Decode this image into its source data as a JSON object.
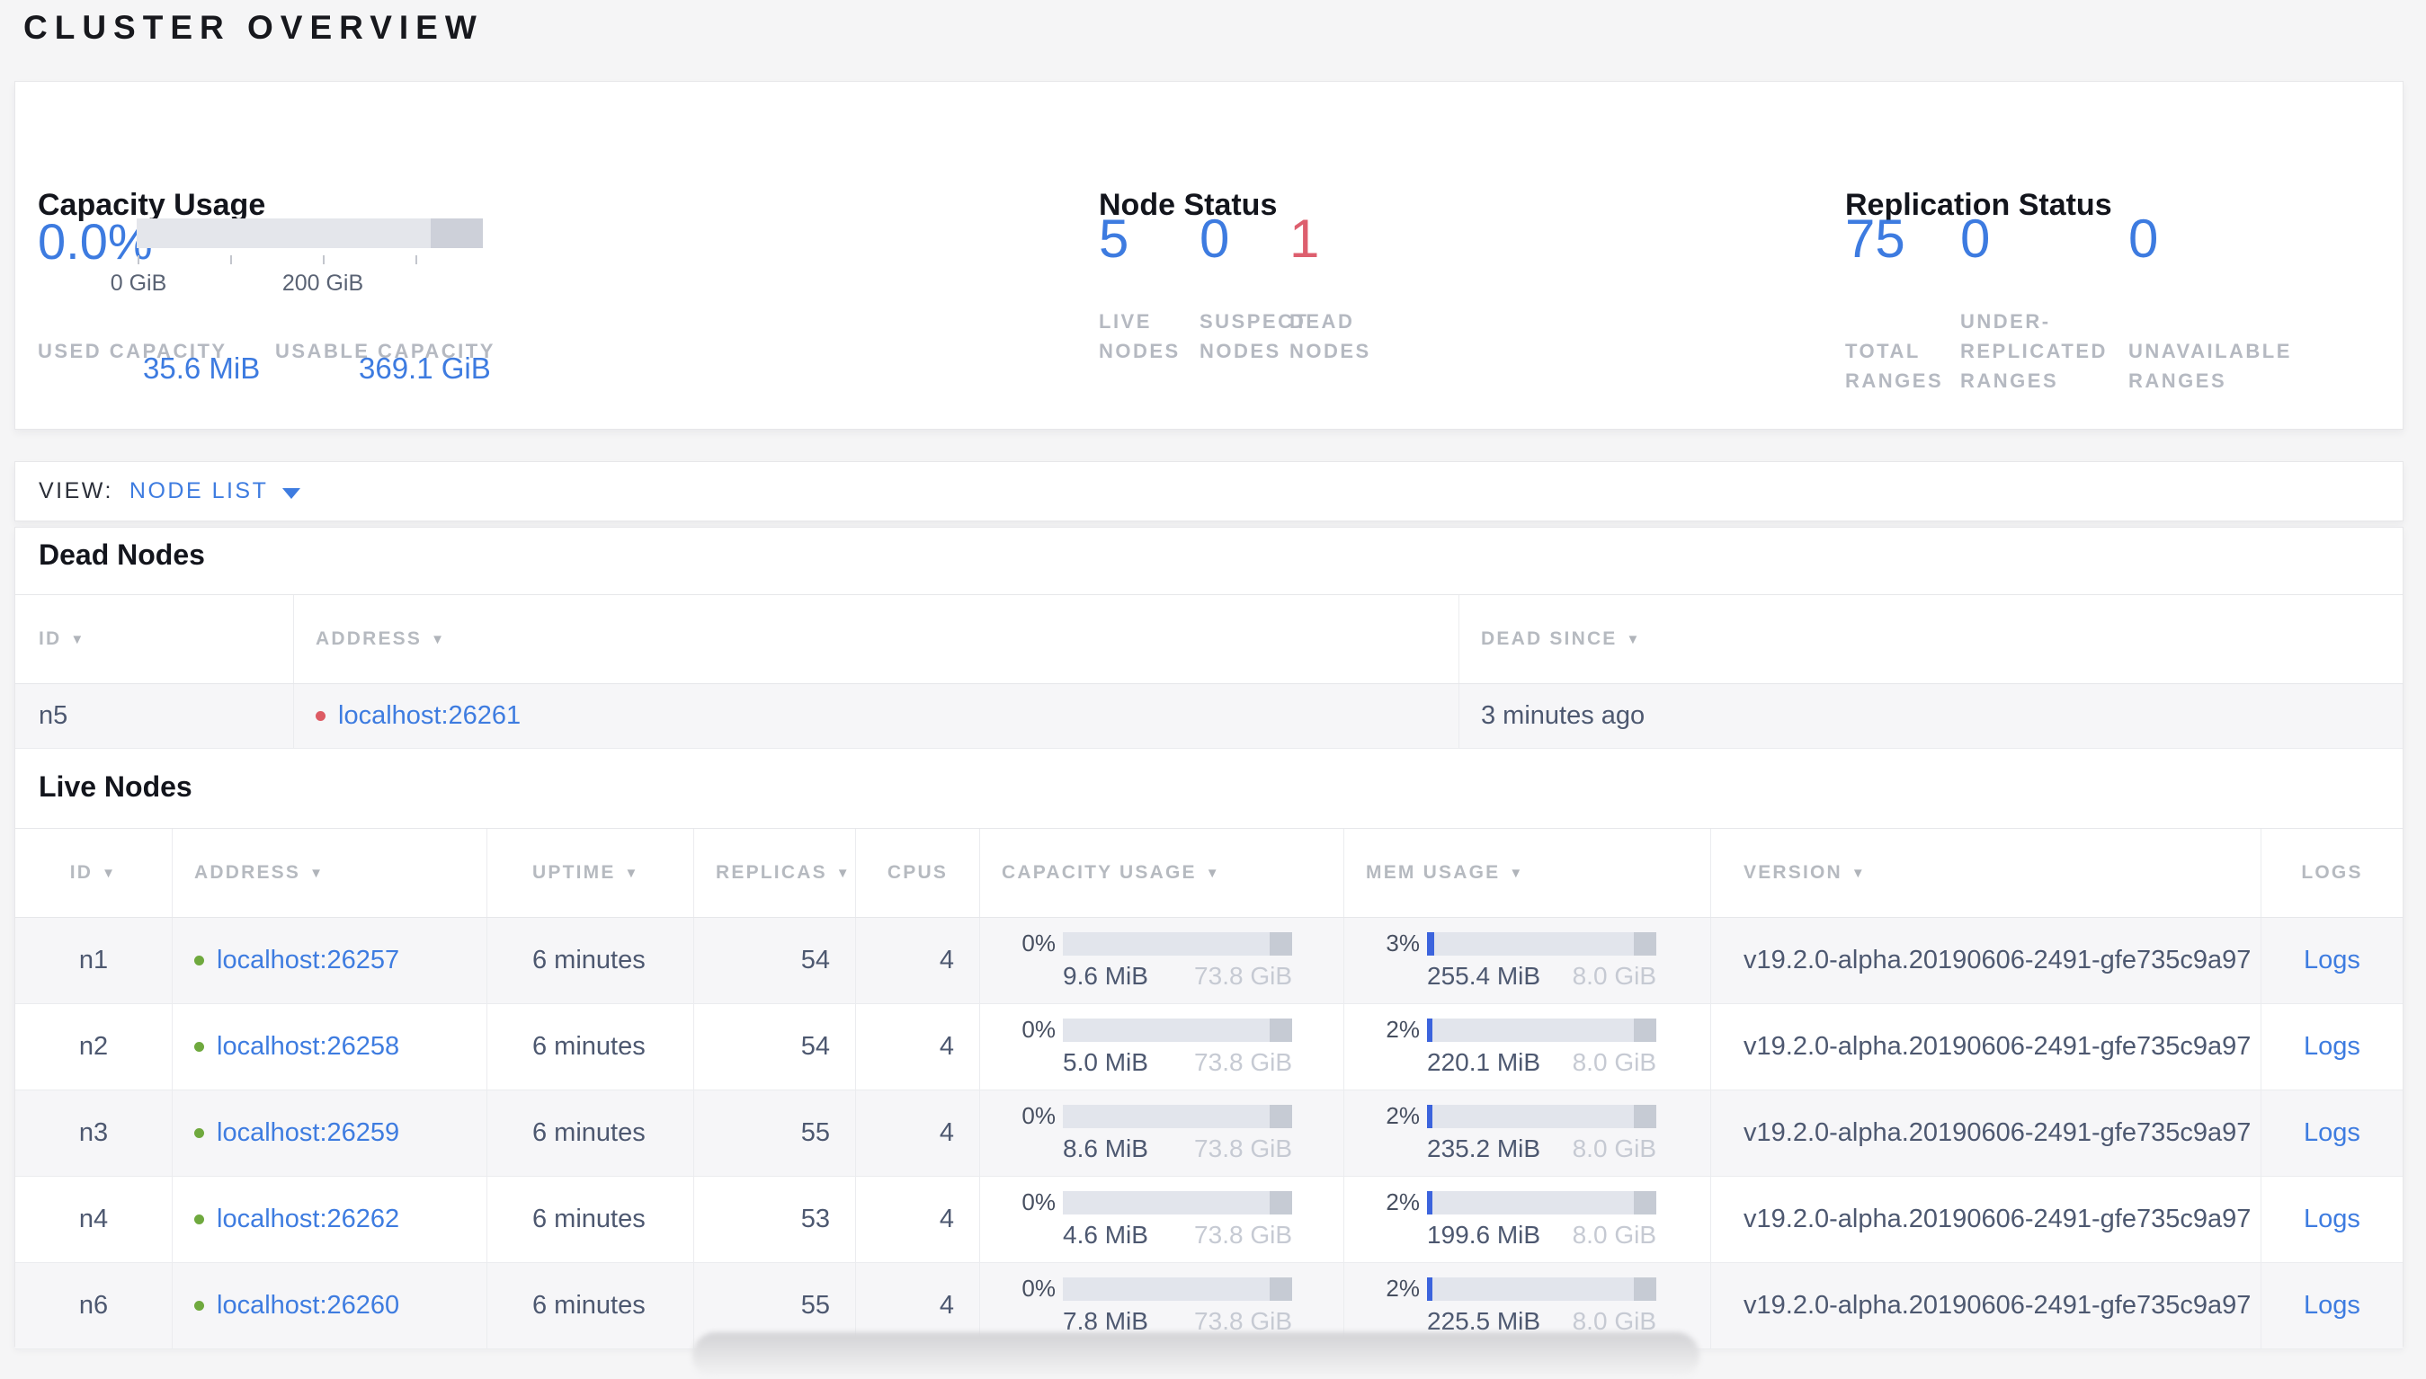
{
  "page": {
    "title": "CLUSTER OVERVIEW"
  },
  "colors": {
    "accent_blue": "#3d7be0",
    "dead_red": "#dd5f6e",
    "live_dot_green": "#6fa93e",
    "dead_dot_red": "#dd5b64",
    "bar_track": "#e2e5ec",
    "bar_other": "#c6cbd4",
    "bar_fill_blue": "#3c64dd"
  },
  "overview": {
    "capacity": {
      "title": "Capacity Usage",
      "percent": "0.0%",
      "tick_labels": [
        "0 GiB",
        "200 GiB"
      ],
      "used_label": "USED\nCAPACITY",
      "used_value": "35.6 MiB",
      "usable_label": "USABLE\nCAPACITY",
      "usable_value": "369.1 GiB"
    },
    "node_status": {
      "title": "Node Status",
      "stats": [
        {
          "value": "5",
          "label": "LIVE\nNODES",
          "state": "live"
        },
        {
          "value": "0",
          "label": "SUSPECT\nNODES",
          "state": "suspect"
        },
        {
          "value": "1",
          "label": "DEAD\nNODES",
          "state": "dead"
        }
      ]
    },
    "replication": {
      "title": "Replication Status",
      "stats": [
        {
          "value": "75",
          "label": "TOTAL\nRANGES"
        },
        {
          "value": "0",
          "label": "UNDER-\nREPLICATED\nRANGES"
        },
        {
          "value": "0",
          "label": "UNAVAILABLE\nRANGES"
        }
      ]
    }
  },
  "view_bar": {
    "label": "VIEW:",
    "selected": "NODE LIST"
  },
  "dead_nodes": {
    "title": "Dead Nodes",
    "columns": [
      {
        "label": "ID",
        "sortable": true
      },
      {
        "label": "ADDRESS",
        "sortable": true
      },
      {
        "label": "DEAD SINCE",
        "sortable": true
      }
    ],
    "rows": [
      {
        "id": "n5",
        "address": "localhost:26261",
        "dead_since": "3 minutes ago"
      }
    ]
  },
  "live_nodes": {
    "title": "Live Nodes",
    "columns": [
      {
        "label": "ID",
        "sortable": true
      },
      {
        "label": "ADDRESS",
        "sortable": true
      },
      {
        "label": "UPTIME",
        "sortable": true
      },
      {
        "label": "REPLICAS",
        "sortable": true
      },
      {
        "label": "CPUS",
        "sortable": false
      },
      {
        "label": "CAPACITY USAGE",
        "sortable": true
      },
      {
        "label": "MEM USAGE",
        "sortable": true
      },
      {
        "label": "VERSION",
        "sortable": true
      },
      {
        "label": "LOGS",
        "sortable": false
      }
    ],
    "rows": [
      {
        "id": "n1",
        "address": "localhost:26257",
        "uptime": "6 minutes",
        "replicas": "54",
        "cpus": "4",
        "cap_pct": "0%",
        "cap_fill": 0,
        "cap_used": "9.6 MiB",
        "cap_total": "73.8 GiB",
        "mem_pct": "3%",
        "mem_fill": 3,
        "mem_used": "255.4 MiB",
        "mem_total": "8.0 GiB",
        "version": "v19.2.0-alpha.20190606-2491-gfe735c9a97",
        "logs": "Logs"
      },
      {
        "id": "n2",
        "address": "localhost:26258",
        "uptime": "6 minutes",
        "replicas": "54",
        "cpus": "4",
        "cap_pct": "0%",
        "cap_fill": 0,
        "cap_used": "5.0 MiB",
        "cap_total": "73.8 GiB",
        "mem_pct": "2%",
        "mem_fill": 2.5,
        "mem_used": "220.1 MiB",
        "mem_total": "8.0 GiB",
        "version": "v19.2.0-alpha.20190606-2491-gfe735c9a97",
        "logs": "Logs"
      },
      {
        "id": "n3",
        "address": "localhost:26259",
        "uptime": "6 minutes",
        "replicas": "55",
        "cpus": "4",
        "cap_pct": "0%",
        "cap_fill": 0,
        "cap_used": "8.6 MiB",
        "cap_total": "73.8 GiB",
        "mem_pct": "2%",
        "mem_fill": 2.5,
        "mem_used": "235.2 MiB",
        "mem_total": "8.0 GiB",
        "version": "v19.2.0-alpha.20190606-2491-gfe735c9a97",
        "logs": "Logs"
      },
      {
        "id": "n4",
        "address": "localhost:26262",
        "uptime": "6 minutes",
        "replicas": "53",
        "cpus": "4",
        "cap_pct": "0%",
        "cap_fill": 0,
        "cap_used": "4.6 MiB",
        "cap_total": "73.8 GiB",
        "mem_pct": "2%",
        "mem_fill": 2.5,
        "mem_used": "199.6 MiB",
        "mem_total": "8.0 GiB",
        "version": "v19.2.0-alpha.20190606-2491-gfe735c9a97",
        "logs": "Logs"
      },
      {
        "id": "n6",
        "address": "localhost:26260",
        "uptime": "6 minutes",
        "replicas": "55",
        "cpus": "4",
        "cap_pct": "0%",
        "cap_fill": 0,
        "cap_used": "7.8 MiB",
        "cap_total": "73.8 GiB",
        "mem_pct": "2%",
        "mem_fill": 2.5,
        "mem_used": "225.5 MiB",
        "mem_total": "8.0 GiB",
        "version": "v19.2.0-alpha.20190606-2491-gfe735c9a97",
        "logs": "Logs"
      }
    ]
  }
}
